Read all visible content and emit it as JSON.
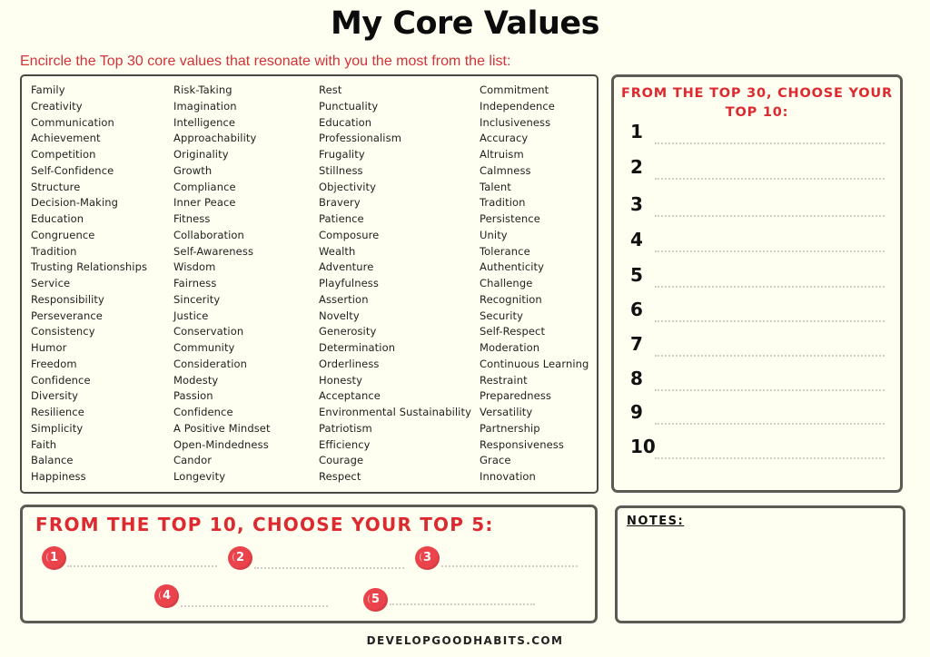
{
  "page": {
    "title": "My Core Values",
    "instruction": "Encircle the Top 30 core values that resonate with you the most from the list:",
    "footer": "DEVELOPGOODHABITS.COM",
    "accent_color": "#dc2a30",
    "badge_color": "#ea434b"
  },
  "values_list": {
    "columns": [
      [
        "Family",
        "Creativity",
        "Communication",
        "Achievement",
        "Competition",
        "Self-Confidence",
        "Structure",
        "Decision-Making",
        "Education",
        "Congruence",
        "Tradition",
        "Trusting Relationships",
        "Service",
        "Responsibility",
        "Perseverance",
        "Consistency",
        "Humor",
        "Freedom",
        "Confidence",
        "Diversity",
        "Resilience",
        "Simplicity",
        "Faith",
        "Balance",
        "Happiness"
      ],
      [
        "Risk-Taking",
        "Imagination",
        "Intelligence",
        "Approachability",
        "Originality",
        "Growth",
        "Compliance",
        "Inner Peace",
        "Fitness",
        "Collaboration",
        "Self-Awareness",
        "Wisdom",
        "Fairness",
        "Sincerity",
        "Justice",
        "Conservation",
        "Community",
        "Consideration",
        "Modesty",
        "Passion",
        "Confidence",
        "A Positive Mindset",
        "Open-Mindedness",
        "Candor",
        "Longevity"
      ],
      [
        "Rest",
        "Punctuality",
        "Education",
        "Professionalism",
        "Frugality",
        "Stillness",
        "Objectivity",
        "Bravery",
        "Patience",
        "Composure",
        "Wealth",
        "Adventure",
        "Playfulness",
        "Assertion",
        "Novelty",
        "Generosity",
        "Determination",
        "Orderliness",
        "Honesty",
        "Acceptance",
        "Environmental Sustainability",
        "Patriotism",
        "Efficiency",
        "Courage",
        "Respect"
      ],
      [
        "Commitment",
        "Independence",
        "Inclusiveness",
        "Accuracy",
        "Altruism",
        "Calmness",
        "Talent",
        "Tradition",
        "Persistence",
        "Unity",
        "Tolerance",
        "Authenticity",
        "Challenge",
        "Recognition",
        "Security",
        "Self-Respect",
        "Moderation",
        "Continuous Learning",
        "Restraint",
        "Preparedness",
        "Versatility",
        "Partnership",
        "Responsiveness",
        "Grace",
        "Innovation"
      ]
    ]
  },
  "top10": {
    "heading": "FROM THE TOP 30, CHOOSE YOUR TOP 10:",
    "items": [
      {
        "number": "1",
        "value": ""
      },
      {
        "number": "2",
        "value": ""
      },
      {
        "number": "3",
        "value": ""
      },
      {
        "number": "4",
        "value": ""
      },
      {
        "number": "5",
        "value": ""
      },
      {
        "number": "6",
        "value": ""
      },
      {
        "number": "7",
        "value": ""
      },
      {
        "number": "8",
        "value": ""
      },
      {
        "number": "9",
        "value": ""
      },
      {
        "number": "10",
        "value": ""
      }
    ]
  },
  "top5": {
    "heading": "FROM THE TOP 10, CHOOSE YOUR TOP 5:",
    "items": [
      {
        "number": "1",
        "value": ""
      },
      {
        "number": "2",
        "value": ""
      },
      {
        "number": "3",
        "value": ""
      },
      {
        "number": "4",
        "value": ""
      },
      {
        "number": "5",
        "value": ""
      }
    ]
  },
  "notes": {
    "heading": "NOTES:",
    "content": ""
  }
}
